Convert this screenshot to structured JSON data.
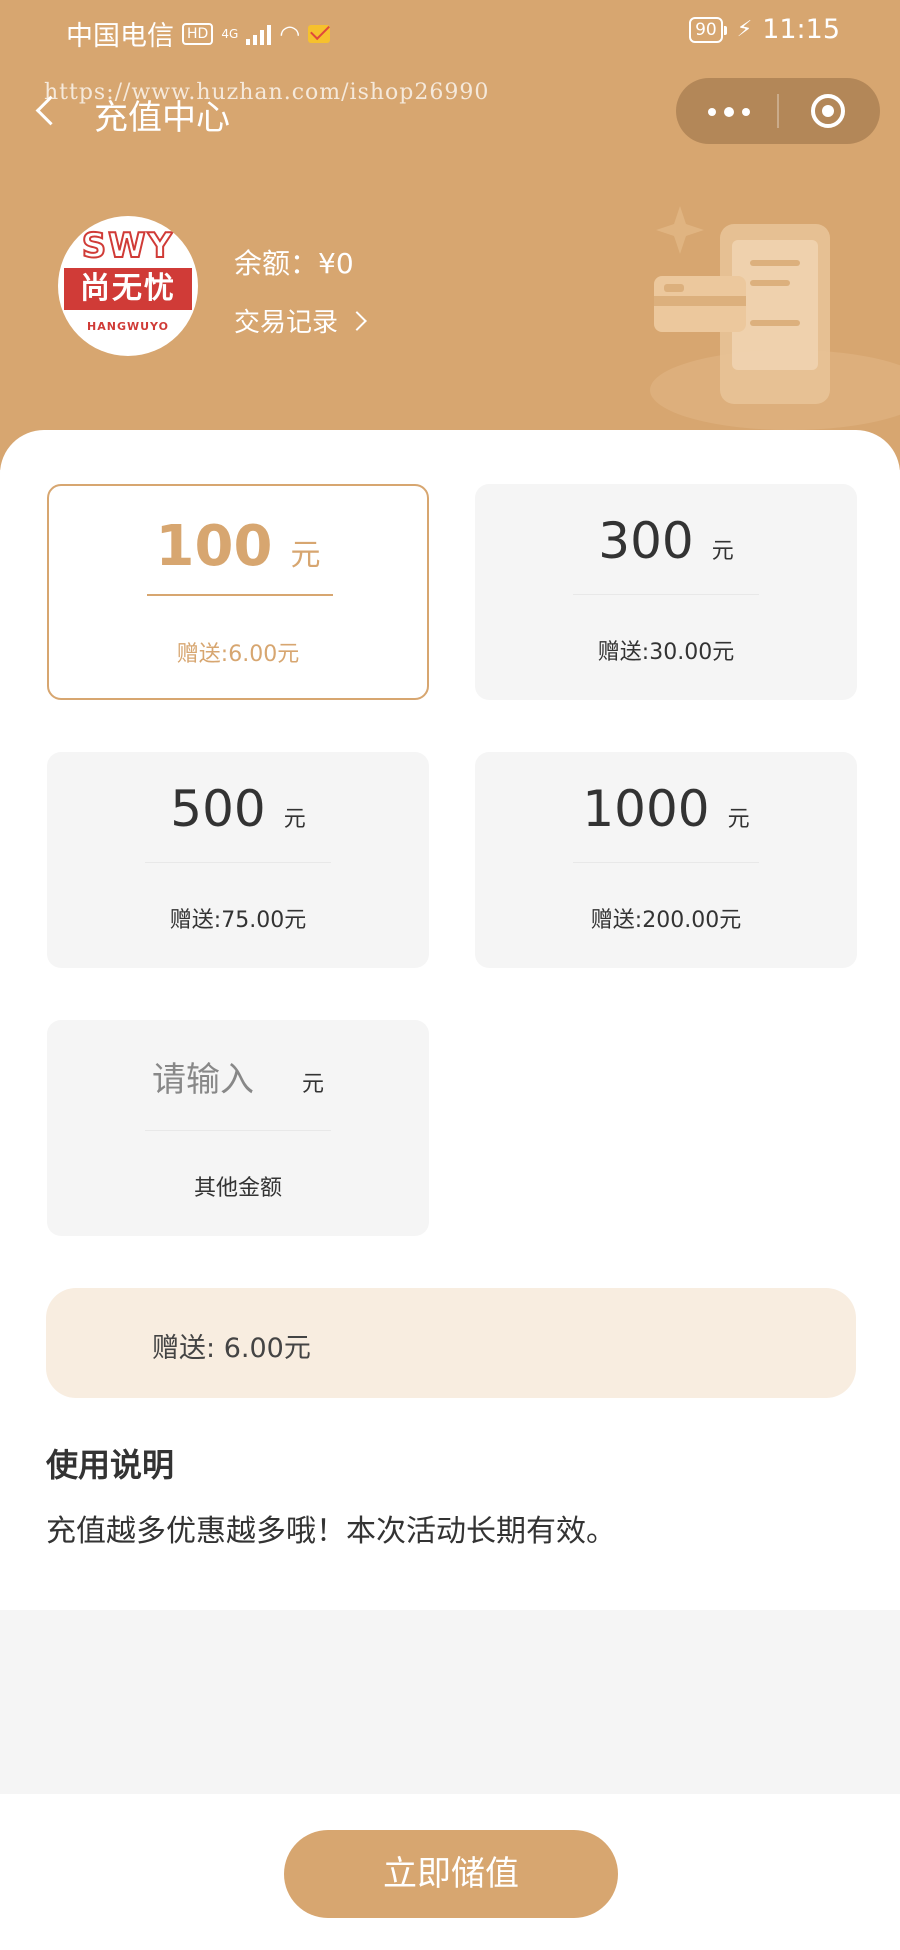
{
  "status_bar": {
    "carrier": "中国电信",
    "hd": "HD",
    "network": "4G",
    "battery": "90",
    "time": "11:15"
  },
  "watermark": "https://www.huzhan.com/ishop26990",
  "nav": {
    "title": "充值中心"
  },
  "account": {
    "logo_top": "SWY",
    "logo_mid": "尚无忧",
    "logo_bottom": "HANGWUYO",
    "balance_label": "余额：",
    "balance_value": "¥0",
    "transaction_link": "交易记录"
  },
  "amounts": [
    {
      "value": "100",
      "unit": "元",
      "gift": "赠送:6.00元",
      "selected": true
    },
    {
      "value": "300",
      "unit": "元",
      "gift": "赠送:30.00元",
      "selected": false
    },
    {
      "value": "500",
      "unit": "元",
      "gift": "赠送:75.00元",
      "selected": false
    },
    {
      "value": "1000",
      "unit": "元",
      "gift": "赠送:200.00元",
      "selected": false
    }
  ],
  "custom_amount": {
    "placeholder": "请输入",
    "unit": "元",
    "label": "其他金额"
  },
  "bonus": {
    "label": "赠送:",
    "value": "6.00元"
  },
  "usage": {
    "title": "使用说明",
    "description": "充值越多优惠越多哦！本次活动长期有效。"
  },
  "submit_button": "立即储值",
  "colors": {
    "accent": "#d7a670",
    "bonus_bg": "#f8ede0",
    "logo_red": "#d03b37"
  }
}
